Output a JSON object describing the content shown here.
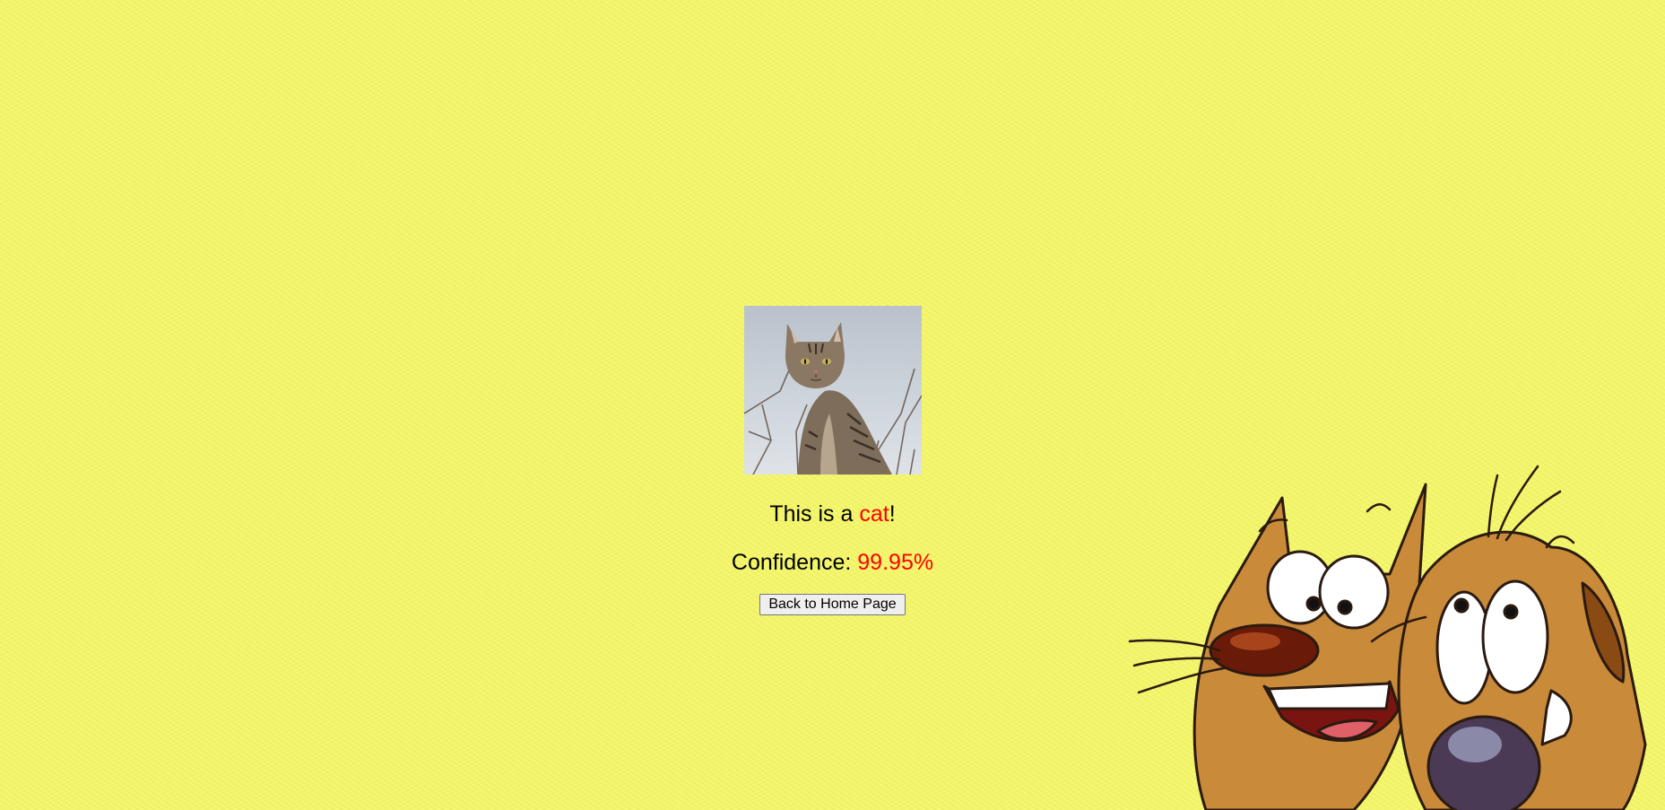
{
  "result": {
    "prefix": "This is a ",
    "label": "cat",
    "suffix": "!"
  },
  "confidence": {
    "prefix": "Confidence: ",
    "value": "99.95%"
  },
  "back_button": {
    "label": "Back to Home Page"
  },
  "colors": {
    "background": "#f6f867",
    "accent": "#ff0000"
  },
  "images": {
    "photo": "tabby-cat-photo",
    "illustration": "catdog-cartoon"
  }
}
